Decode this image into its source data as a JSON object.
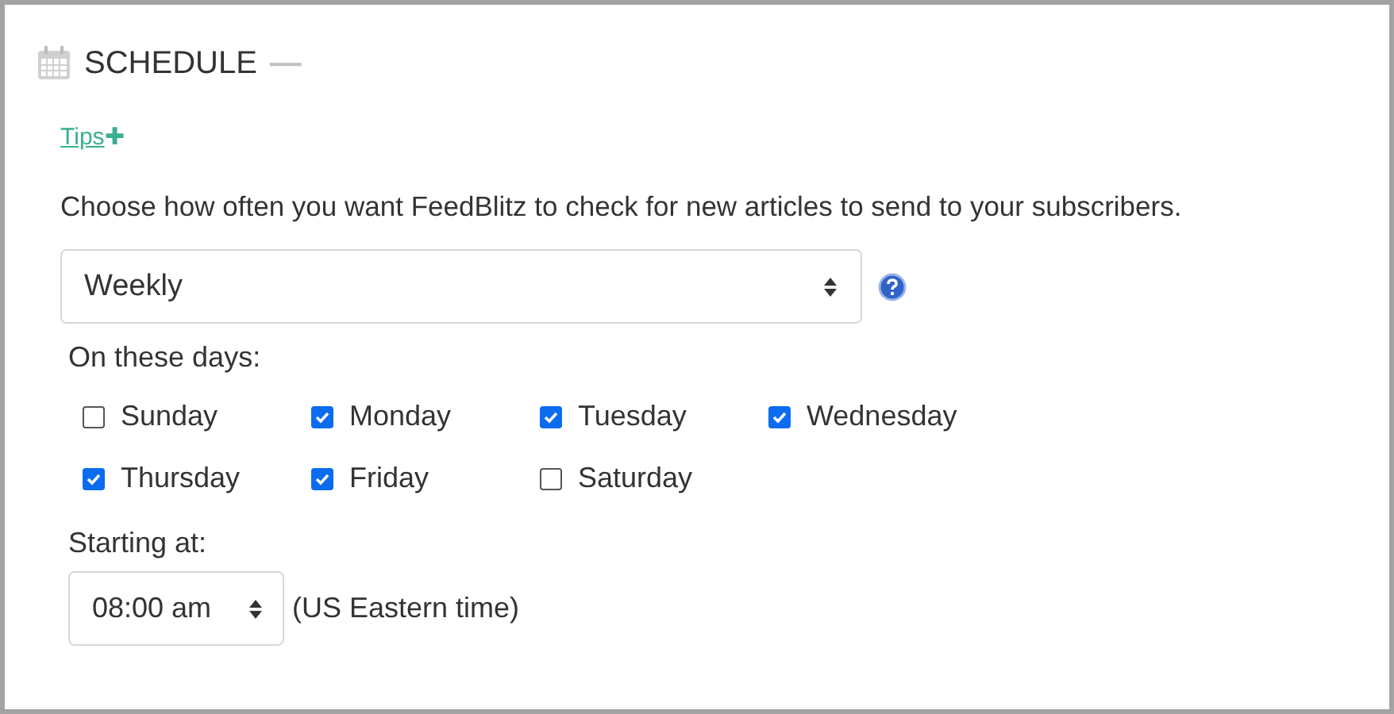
{
  "section": {
    "title": "SCHEDULE",
    "collapse": "—"
  },
  "tips": {
    "label": "Tips",
    "icon": "✚"
  },
  "intro": "Choose how often you want FeedBlitz to check for new articles to send to your subscribers.",
  "frequency": {
    "value": "Weekly"
  },
  "days_label": "On these days:",
  "days": [
    {
      "label": "Sunday",
      "checked": false
    },
    {
      "label": "Monday",
      "checked": true
    },
    {
      "label": "Tuesday",
      "checked": true
    },
    {
      "label": "Wednesday",
      "checked": true
    },
    {
      "label": "Thursday",
      "checked": true
    },
    {
      "label": "Friday",
      "checked": true
    },
    {
      "label": "Saturday",
      "checked": false
    }
  ],
  "start_label": "Starting at:",
  "start_time": {
    "value": "08:00 am"
  },
  "timezone": "(US Eastern time)"
}
